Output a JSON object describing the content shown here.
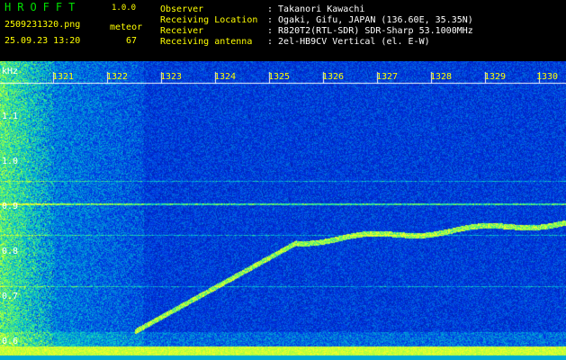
{
  "header": {
    "logo": "HROFFT",
    "version": "1.0.0",
    "filename": "2509231320.png",
    "datetime": "25.09.23 13:20",
    "meteor_label": "meteor",
    "meteor_count": "67",
    "info": [
      {
        "label": "Observer",
        "value": ": Takanori Kawachi"
      },
      {
        "label": "Receiving Location",
        "value": ": Ogaki, Gifu, JAPAN (136.60E, 35.35N)"
      },
      {
        "label": "Receiver",
        "value": ": R820T2(RTL-SDR) SDR-Sharp 53.1000MHz"
      },
      {
        "label": "Receiving antenna",
        "value": ": 2el-HB9CV Vertical (el. E-W)"
      }
    ]
  },
  "axis": {
    "y_unit": "kHz",
    "y_ticks": [
      "1.1",
      "1.0",
      "0.9",
      "0.8",
      "0.7",
      "0.6"
    ],
    "time_ticks": [
      "1321",
      "1322",
      "1323",
      "1324",
      "1325",
      "1326",
      "1327",
      "1328",
      "1329",
      "1330"
    ]
  },
  "colors": {
    "background": "#000000",
    "label_yellow": "#ffff00",
    "info_green": "#00e000",
    "spectrum_low": "#000a80",
    "spectrum_high": "#ffff40"
  }
}
